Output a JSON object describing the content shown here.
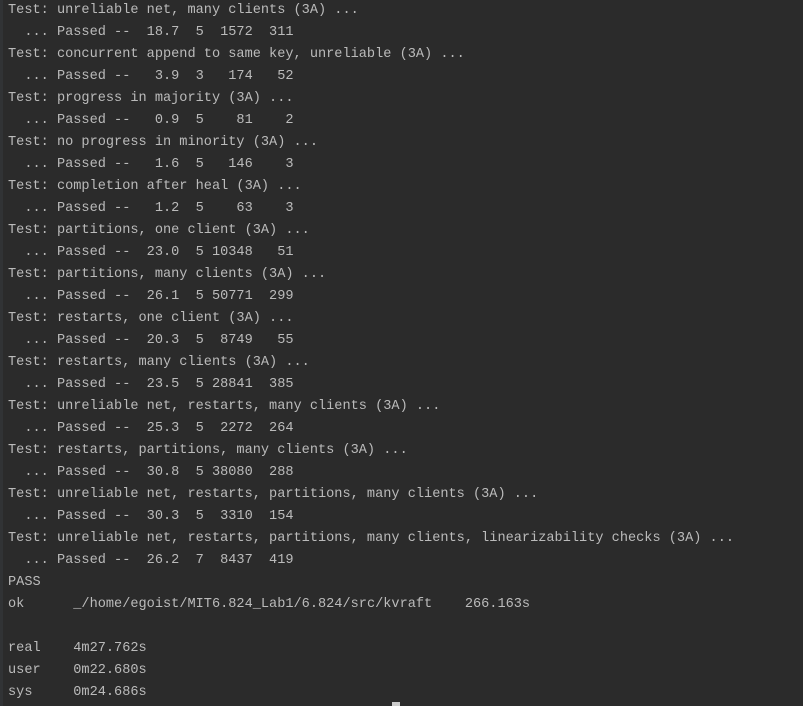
{
  "terminal": {
    "lines": [
      "Test: unreliable net, many clients (3A) ...",
      "  ... Passed --  18.7  5  1572  311",
      "Test: concurrent append to same key, unreliable (3A) ...",
      "  ... Passed --   3.9  3   174   52",
      "Test: progress in majority (3A) ...",
      "  ... Passed --   0.9  5    81    2",
      "Test: no progress in minority (3A) ...",
      "  ... Passed --   1.6  5   146    3",
      "Test: completion after heal (3A) ...",
      "  ... Passed --   1.2  5    63    3",
      "Test: partitions, one client (3A) ...",
      "  ... Passed --  23.0  5 10348   51",
      "Test: partitions, many clients (3A) ...",
      "  ... Passed --  26.1  5 50771  299",
      "Test: restarts, one client (3A) ...",
      "  ... Passed --  20.3  5  8749   55",
      "Test: restarts, many clients (3A) ...",
      "  ... Passed --  23.5  5 28841  385",
      "Test: unreliable net, restarts, many clients (3A) ...",
      "  ... Passed --  25.3  5  2272  264",
      "Test: restarts, partitions, many clients (3A) ...",
      "  ... Passed --  30.8  5 38080  288",
      "Test: unreliable net, restarts, partitions, many clients (3A) ...",
      "  ... Passed --  30.3  5  3310  154",
      "Test: unreliable net, restarts, partitions, many clients, linearizability checks (3A) ...",
      "  ... Passed --  26.2  7  8437  419",
      "PASS",
      "ok  \t_/home/egoist/MIT6.824_Lab1/6.824/src/kvraft\t266.163s",
      "",
      "real\t4m27.762s",
      "user\t0m22.680s",
      "sys\t0m24.686s"
    ]
  }
}
